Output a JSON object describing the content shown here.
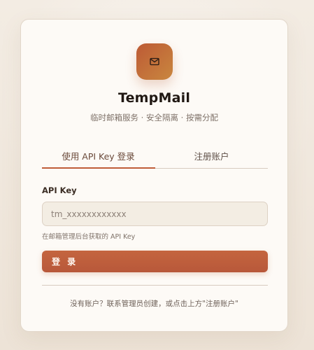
{
  "app": {
    "title": "TempMail",
    "subtitle": "临时邮箱服务 · 安全隔离 · 按需分配"
  },
  "logo": {
    "icon": "mail-icon"
  },
  "tabs": [
    {
      "label": "使用 API Key 登录",
      "active": true
    },
    {
      "label": "注册账户",
      "active": false
    }
  ],
  "form": {
    "api_key_label": "API Key",
    "api_key_placeholder": "tm_xxxxxxxxxxxx",
    "hint": "在邮箱管理后台获取的 API Key",
    "submit_label": "登 录"
  },
  "footer": {
    "text": "没有账户？联系管理员创建，或点击上方\"注册账户\""
  },
  "colors": {
    "accent": "#bf5d39",
    "background": "#efe6da",
    "card": "#fdfaf6"
  }
}
